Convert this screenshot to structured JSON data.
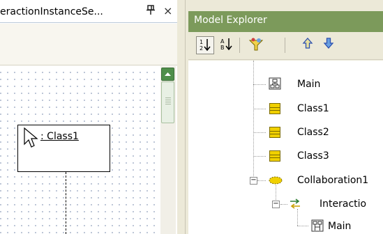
{
  "left_pane": {
    "tab_title": "eractionInstanceSe...",
    "pin_glyph": "Ԅ",
    "close_glyph": "×",
    "lifeline_label": ": Class1"
  },
  "model_explorer": {
    "title": "Model Explorer",
    "header_color": "#7c9a5b",
    "toolbar": {
      "sort_asc_icon": "1↓",
      "sort_alpha_icon": "A↓",
      "filter_icon": "✧",
      "move_up_icon": "⇧",
      "move_down_icon": "⇩"
    },
    "tree": [
      {
        "label": "Main",
        "icon": "diagram-icon"
      },
      {
        "label": "Class1",
        "icon": "class-icon"
      },
      {
        "label": "Class2",
        "icon": "class-icon"
      },
      {
        "label": "Class3",
        "icon": "class-icon"
      },
      {
        "label": "Collaboration1",
        "icon": "collaboration-icon"
      },
      {
        "label": "Interactio",
        "icon": "interaction-icon"
      },
      {
        "label": "Main",
        "icon": "sequence-diagram-icon"
      }
    ]
  }
}
